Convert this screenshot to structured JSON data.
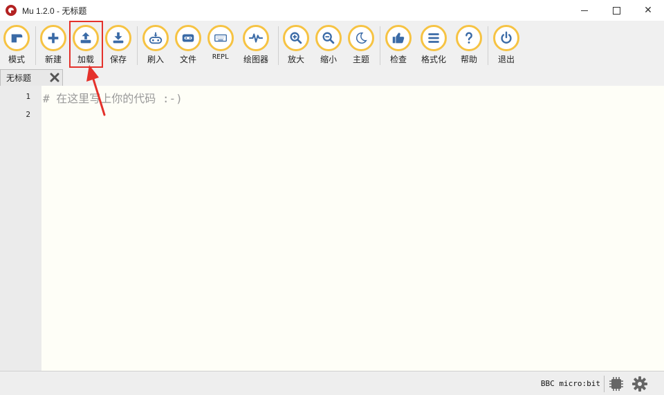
{
  "window": {
    "title": "Mu 1.2.0 - 无标题",
    "close_glyph": "✕"
  },
  "toolbar": {
    "buttons": [
      {
        "id": "mode",
        "label": "模式",
        "icon": "mode-icon"
      },
      {
        "id": "new",
        "label": "新建",
        "icon": "plus-icon"
      },
      {
        "id": "load",
        "label": "加载",
        "icon": "upload-icon"
      },
      {
        "id": "save",
        "label": "保存",
        "icon": "download-icon"
      },
      {
        "id": "flash",
        "label": "刷入",
        "icon": "flash-icon"
      },
      {
        "id": "files",
        "label": "文件",
        "icon": "microbit-icon"
      },
      {
        "id": "repl",
        "label": "REPL",
        "icon": "keyboard-icon"
      },
      {
        "id": "plotter",
        "label": "绘图器",
        "icon": "pulse-icon"
      },
      {
        "id": "zoom_in",
        "label": "放大",
        "icon": "zoom-in-icon"
      },
      {
        "id": "zoom_out",
        "label": "缩小",
        "icon": "zoom-out-icon"
      },
      {
        "id": "theme",
        "label": "主题",
        "icon": "moon-icon"
      },
      {
        "id": "check",
        "label": "检查",
        "icon": "thumbs-up-icon"
      },
      {
        "id": "tidy",
        "label": "格式化",
        "icon": "lines-icon"
      },
      {
        "id": "help",
        "label": "帮助",
        "icon": "question-icon"
      },
      {
        "id": "quit",
        "label": "退出",
        "icon": "power-icon"
      }
    ],
    "highlighted": "load"
  },
  "tabs": [
    {
      "label": "无标题",
      "active": true
    }
  ],
  "editor": {
    "line_numbers": [
      "1",
      "2"
    ],
    "lines": [
      "# 在这里写上你的代码 :-)",
      ""
    ]
  },
  "status": {
    "mode": "BBC micro:bit"
  },
  "colors": {
    "button_ring": "#f6c343",
    "icon": "#3a6aa6",
    "annotation": "#e4312b",
    "editor_bg": "#fefef7"
  }
}
